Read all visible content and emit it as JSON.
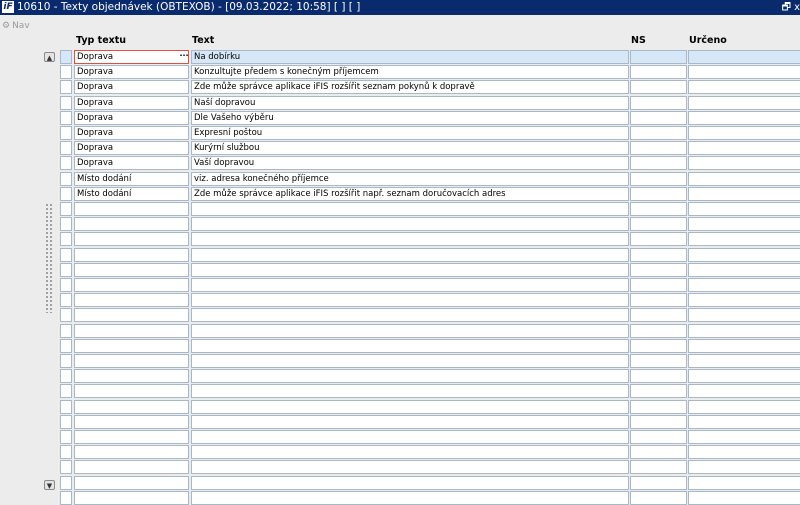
{
  "window": {
    "app_icon": "iFIS-logo-icon",
    "title": "10610 - Texty objednávek (OBTEXOB) - [09.03.2022; 10:58]  [ ]  [ ]",
    "restore_glyph": "🗗",
    "close_glyph": "x"
  },
  "nav": {
    "label": "Nav",
    "icon": "gear-icon"
  },
  "columns": {
    "typ": "Typ textu",
    "text": "Text",
    "ns": "NS",
    "urceno": "Určeno"
  },
  "scroll": {
    "up": "▲",
    "down": "▼"
  },
  "active_cell_button": "···",
  "rows": [
    {
      "typ": "Doprava",
      "text": "Na dobírku",
      "ns": "",
      "urceno": ""
    },
    {
      "typ": "Doprava",
      "text": "Konzultujte předem s konečným příjemcem",
      "ns": "",
      "urceno": ""
    },
    {
      "typ": "Doprava",
      "text": "Zde může správce aplikace iFIS rozšířit seznam pokynů k dopravě",
      "ns": "",
      "urceno": ""
    },
    {
      "typ": "Doprava",
      "text": "Naší dopravou",
      "ns": "",
      "urceno": ""
    },
    {
      "typ": "Doprava",
      "text": "Dle Vašeho výběru",
      "ns": "",
      "urceno": ""
    },
    {
      "typ": "Doprava",
      "text": "Expresní poštou",
      "ns": "",
      "urceno": ""
    },
    {
      "typ": "Doprava",
      "text": "Kurýrní službou",
      "ns": "",
      "urceno": ""
    },
    {
      "typ": "Doprava",
      "text": "Vaší dopravou",
      "ns": "",
      "urceno": ""
    },
    {
      "typ": "Místo dodání",
      "text": "viz. adresa konečného příjemce",
      "ns": "",
      "urceno": ""
    },
    {
      "typ": "Místo dodání",
      "text": "Zde může správce aplikace iFIS rozšířit např. seznam doručovacích adres",
      "ns": "",
      "urceno": ""
    },
    {
      "typ": "",
      "text": "",
      "ns": "",
      "urceno": ""
    },
    {
      "typ": "",
      "text": "",
      "ns": "",
      "urceno": ""
    },
    {
      "typ": "",
      "text": "",
      "ns": "",
      "urceno": ""
    },
    {
      "typ": "",
      "text": "",
      "ns": "",
      "urceno": ""
    },
    {
      "typ": "",
      "text": "",
      "ns": "",
      "urceno": ""
    },
    {
      "typ": "",
      "text": "",
      "ns": "",
      "urceno": ""
    },
    {
      "typ": "",
      "text": "",
      "ns": "",
      "urceno": ""
    },
    {
      "typ": "",
      "text": "",
      "ns": "",
      "urceno": ""
    },
    {
      "typ": "",
      "text": "",
      "ns": "",
      "urceno": ""
    },
    {
      "typ": "",
      "text": "",
      "ns": "",
      "urceno": ""
    },
    {
      "typ": "",
      "text": "",
      "ns": "",
      "urceno": ""
    },
    {
      "typ": "",
      "text": "",
      "ns": "",
      "urceno": ""
    },
    {
      "typ": "",
      "text": "",
      "ns": "",
      "urceno": ""
    },
    {
      "typ": "",
      "text": "",
      "ns": "",
      "urceno": ""
    },
    {
      "typ": "",
      "text": "",
      "ns": "",
      "urceno": ""
    },
    {
      "typ": "",
      "text": "",
      "ns": "",
      "urceno": ""
    },
    {
      "typ": "",
      "text": "",
      "ns": "",
      "urceno": ""
    },
    {
      "typ": "",
      "text": "",
      "ns": "",
      "urceno": ""
    },
    {
      "typ": "",
      "text": "",
      "ns": "",
      "urceno": ""
    },
    {
      "typ": "",
      "text": "",
      "ns": "",
      "urceno": ""
    }
  ]
}
